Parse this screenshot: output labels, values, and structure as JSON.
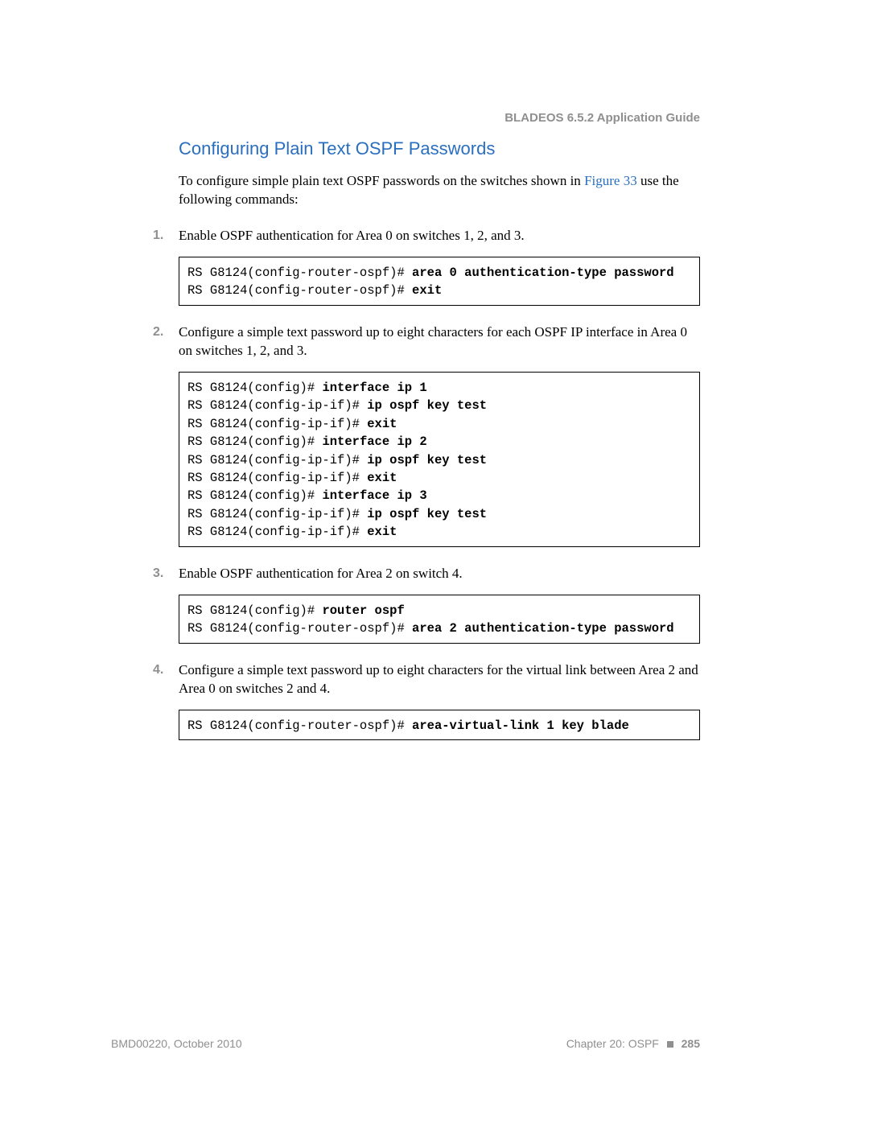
{
  "header": {
    "running_head": "BLADEOS 6.5.2 Application Guide"
  },
  "section": {
    "title": "Configuring Plain Text OSPF Passwords",
    "intro_pre": "To configure simple plain text OSPF passwords on the switches shown in ",
    "intro_link": "Figure 33",
    "intro_post": " use the following commands:"
  },
  "steps": [
    {
      "text": "Enable OSPF authentication for Area 0 on switches 1, 2, and 3.",
      "code": [
        {
          "prompt": "RS G8124(config-router-ospf)# ",
          "cmd": "area 0 authentication-type password"
        },
        {
          "prompt": "RS G8124(config-router-ospf)# ",
          "cmd": "exit"
        }
      ]
    },
    {
      "text": "Configure a simple text password up to eight characters for each OSPF IP interface in Area 0 on switches 1, 2, and 3.",
      "code": [
        {
          "prompt": "RS G8124(config)# ",
          "cmd": "interface ip 1"
        },
        {
          "prompt": "RS G8124(config-ip-if)# ",
          "cmd": "ip ospf key test"
        },
        {
          "prompt": "RS G8124(config-ip-if)# ",
          "cmd": "exit"
        },
        {
          "prompt": "RS G8124(config)# ",
          "cmd": "interface ip 2"
        },
        {
          "prompt": "RS G8124(config-ip-if)# ",
          "cmd": "ip ospf key test"
        },
        {
          "prompt": "RS G8124(config-ip-if)# ",
          "cmd": "exit"
        },
        {
          "prompt": "RS G8124(config)# ",
          "cmd": "interface ip 3"
        },
        {
          "prompt": "RS G8124(config-ip-if)# ",
          "cmd": "ip ospf key test"
        },
        {
          "prompt": "RS G8124(config-ip-if)# ",
          "cmd": "exit"
        }
      ]
    },
    {
      "text": "Enable OSPF authentication for Area 2 on switch 4.",
      "code": [
        {
          "prompt": "RS G8124(config)# ",
          "cmd": "router ospf"
        },
        {
          "prompt": "RS G8124(config-router-ospf)# ",
          "cmd": "area 2 authentication-type password"
        }
      ]
    },
    {
      "text": "Configure a simple text password up to eight characters for the virtual link between Area 2 and Area 0 on switches 2 and 4.",
      "code": [
        {
          "prompt": "RS G8124(config-router-ospf)# ",
          "cmd": "area-virtual-link 1 key blade"
        }
      ]
    }
  ],
  "footer": {
    "left": "BMD00220, October 2010",
    "chapter": "Chapter 20: OSPF",
    "page": "285"
  }
}
